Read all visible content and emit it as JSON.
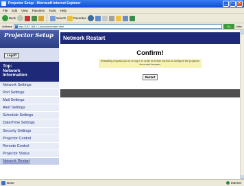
{
  "window": {
    "title": "Projector Setup - Microsoft Internet Explorer"
  },
  "menubar": {
    "items": [
      "File",
      "Edit",
      "View",
      "Favorites",
      "Tools",
      "Help"
    ]
  },
  "toolbar": {
    "back_label": "Back",
    "search_label": "Search",
    "favorites_label": "Favorites"
  },
  "addressbar": {
    "label": "Address",
    "value": "http://192.168.1.10/admin/restart.html",
    "go_label": "Go",
    "links_label": "Links"
  },
  "sidebar": {
    "logo_text": "Projector Setup",
    "logout_label": "Logoff",
    "top_text": "Top:\nNetwork\nInformation",
    "items": [
      "Network Settings",
      "Port Settings",
      "Mail Settings",
      "Alert Settings",
      "Schedule Settings",
      "Date/Time Settings",
      "Security Settings",
      "Projector Control",
      "Remote Control",
      "Projector Status",
      "Network Restart"
    ]
  },
  "main": {
    "header": "Network Restart",
    "confirm_title": "Confirm!",
    "message": "Restarting requires you to re-log in in order to further control or configure the projector via a web browser.",
    "restart_label": "Restart"
  },
  "statusbar": {
    "status": "Done",
    "zone": "Internet"
  }
}
